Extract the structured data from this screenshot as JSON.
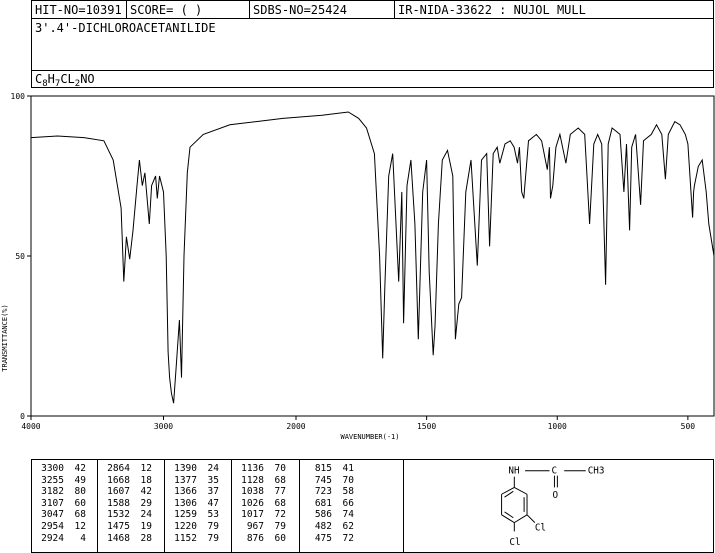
{
  "header": {
    "hit_no": "HIT-NO=10391",
    "score": "SCORE=  (   )",
    "sdbs_no": "SDBS-NO=25424",
    "ir_nida": "IR-NIDA-33622 : NUJOL MULL"
  },
  "compound_name": "3'.4'-DICHLOROACETANILIDE",
  "formula": {
    "parts": [
      {
        "text": "C",
        "sub": false
      },
      {
        "text": "8",
        "sub": true
      },
      {
        "text": "H",
        "sub": false
      },
      {
        "text": "7",
        "sub": true
      },
      {
        "text": "CL",
        "sub": false
      },
      {
        "text": "2",
        "sub": true
      },
      {
        "text": "NO",
        "sub": false
      }
    ]
  },
  "chart_data": {
    "type": "line",
    "xlabel": "WAVENUMBER(-1)",
    "ylabel": "TRANSMITTANCE(%)",
    "xlim": [
      4000,
      400
    ],
    "ylim": [
      0,
      100
    ],
    "x_ticks": [
      4000,
      3000,
      2000,
      1500,
      1000,
      500
    ],
    "y_ticks": [
      0,
      50,
      100
    ],
    "grid": false,
    "baseline": [
      [
        4000,
        87
      ],
      [
        3800,
        87.5
      ],
      [
        3600,
        87
      ],
      [
        3450,
        86
      ],
      [
        3380,
        80
      ],
      [
        3320,
        65
      ],
      [
        3300,
        42
      ],
      [
        3280,
        56
      ],
      [
        3255,
        49
      ],
      [
        3230,
        58
      ],
      [
        3200,
        72
      ],
      [
        3182,
        80
      ],
      [
        3160,
        72
      ],
      [
        3140,
        76
      ],
      [
        3107,
        60
      ],
      [
        3090,
        72
      ],
      [
        3060,
        75
      ],
      [
        3047,
        68
      ],
      [
        3030,
        75
      ],
      [
        3000,
        70
      ],
      [
        2980,
        50
      ],
      [
        2965,
        20
      ],
      [
        2954,
        12
      ],
      [
        2940,
        7
      ],
      [
        2924,
        4
      ],
      [
        2905,
        15
      ],
      [
        2880,
        30
      ],
      [
        2864,
        12
      ],
      [
        2845,
        50
      ],
      [
        2820,
        76
      ],
      [
        2800,
        84
      ],
      [
        2700,
        88
      ],
      [
        2500,
        91
      ],
      [
        2300,
        92
      ],
      [
        2100,
        93
      ],
      [
        1900,
        94
      ],
      [
        1800,
        95
      ],
      [
        1760,
        93
      ],
      [
        1730,
        90
      ],
      [
        1700,
        82
      ],
      [
        1680,
        50
      ],
      [
        1668,
        18
      ],
      [
        1660,
        40
      ],
      [
        1645,
        75
      ],
      [
        1630,
        82
      ],
      [
        1607,
        42
      ],
      [
        1595,
        70
      ],
      [
        1588,
        29
      ],
      [
        1575,
        72
      ],
      [
        1560,
        80
      ],
      [
        1545,
        60
      ],
      [
        1532,
        24
      ],
      [
        1515,
        70
      ],
      [
        1500,
        80
      ],
      [
        1490,
        45
      ],
      [
        1475,
        19
      ],
      [
        1468,
        28
      ],
      [
        1455,
        60
      ],
      [
        1440,
        80
      ],
      [
        1420,
        83
      ],
      [
        1400,
        75
      ],
      [
        1390,
        24
      ],
      [
        1377,
        35
      ],
      [
        1366,
        37
      ],
      [
        1350,
        70
      ],
      [
        1330,
        80
      ],
      [
        1306,
        47
      ],
      [
        1290,
        80
      ],
      [
        1270,
        82
      ],
      [
        1259,
        53
      ],
      [
        1245,
        82
      ],
      [
        1230,
        84
      ],
      [
        1220,
        79
      ],
      [
        1200,
        85
      ],
      [
        1180,
        86
      ],
      [
        1165,
        84
      ],
      [
        1152,
        79
      ],
      [
        1145,
        84
      ],
      [
        1136,
        70
      ],
      [
        1128,
        68
      ],
      [
        1110,
        86
      ],
      [
        1080,
        88
      ],
      [
        1060,
        86
      ],
      [
        1038,
        77
      ],
      [
        1030,
        84
      ],
      [
        1026,
        68
      ],
      [
        1017,
        72
      ],
      [
        1005,
        84
      ],
      [
        990,
        88
      ],
      [
        967,
        79
      ],
      [
        950,
        88
      ],
      [
        920,
        90
      ],
      [
        895,
        88
      ],
      [
        876,
        60
      ],
      [
        860,
        85
      ],
      [
        845,
        88
      ],
      [
        830,
        85
      ],
      [
        815,
        41
      ],
      [
        805,
        85
      ],
      [
        790,
        90
      ],
      [
        760,
        88
      ],
      [
        745,
        70
      ],
      [
        735,
        85
      ],
      [
        723,
        58
      ],
      [
        715,
        84
      ],
      [
        700,
        88
      ],
      [
        681,
        66
      ],
      [
        670,
        86
      ],
      [
        640,
        88
      ],
      [
        620,
        91
      ],
      [
        600,
        88
      ],
      [
        586,
        74
      ],
      [
        575,
        88
      ],
      [
        550,
        92
      ],
      [
        530,
        91
      ],
      [
        510,
        88
      ],
      [
        500,
        85
      ],
      [
        482,
        62
      ],
      [
        478,
        70
      ],
      [
        475,
        72
      ],
      [
        460,
        78
      ],
      [
        445,
        80
      ],
      [
        430,
        70
      ],
      [
        420,
        60
      ],
      [
        410,
        55
      ],
      [
        400,
        50
      ]
    ],
    "peaks": [
      {
        "wavenumber": 3300,
        "transmittance": 42
      },
      {
        "wavenumber": 3255,
        "transmittance": 49
      },
      {
        "wavenumber": 3182,
        "transmittance": 80
      },
      {
        "wavenumber": 3107,
        "transmittance": 60
      },
      {
        "wavenumber": 3047,
        "transmittance": 68
      },
      {
        "wavenumber": 2954,
        "transmittance": 12
      },
      {
        "wavenumber": 2924,
        "transmittance": 4
      },
      {
        "wavenumber": 2864,
        "transmittance": 12
      },
      {
        "wavenumber": 1668,
        "transmittance": 18
      },
      {
        "wavenumber": 1607,
        "transmittance": 42
      },
      {
        "wavenumber": 1588,
        "transmittance": 29
      },
      {
        "wavenumber": 1532,
        "transmittance": 24
      },
      {
        "wavenumber": 1475,
        "transmittance": 19
      },
      {
        "wavenumber": 1468,
        "transmittance": 28
      },
      {
        "wavenumber": 1390,
        "transmittance": 24
      },
      {
        "wavenumber": 1377,
        "transmittance": 35
      },
      {
        "wavenumber": 1366,
        "transmittance": 37
      },
      {
        "wavenumber": 1306,
        "transmittance": 47
      },
      {
        "wavenumber": 1259,
        "transmittance": 53
      },
      {
        "wavenumber": 1220,
        "transmittance": 79
      },
      {
        "wavenumber": 1152,
        "transmittance": 79
      },
      {
        "wavenumber": 1136,
        "transmittance": 70
      },
      {
        "wavenumber": 1128,
        "transmittance": 68
      },
      {
        "wavenumber": 1038,
        "transmittance": 77
      },
      {
        "wavenumber": 1026,
        "transmittance": 68
      },
      {
        "wavenumber": 1017,
        "transmittance": 72
      },
      {
        "wavenumber": 967,
        "transmittance": 79
      },
      {
        "wavenumber": 876,
        "transmittance": 60
      },
      {
        "wavenumber": 815,
        "transmittance": 41
      },
      {
        "wavenumber": 745,
        "transmittance": 70
      },
      {
        "wavenumber": 723,
        "transmittance": 58
      },
      {
        "wavenumber": 681,
        "transmittance": 66
      },
      {
        "wavenumber": 586,
        "transmittance": 74
      },
      {
        "wavenumber": 482,
        "transmittance": 62
      },
      {
        "wavenumber": 475,
        "transmittance": 72
      }
    ]
  },
  "structure": {
    "labels": [
      "NH",
      "C",
      "CH3",
      "O",
      "Cl",
      "Cl"
    ]
  }
}
